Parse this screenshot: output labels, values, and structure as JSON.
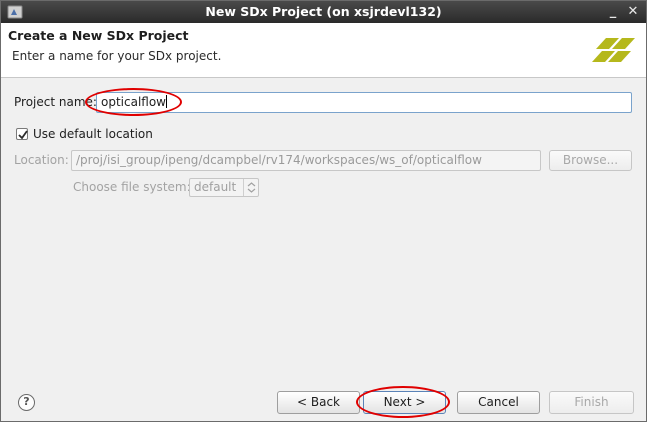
{
  "window": {
    "title": "New SDx Project  (on xsjrdevl132)",
    "controls": {
      "minimize": "_",
      "close": "✕"
    }
  },
  "header": {
    "title": "Create a New SDx Project",
    "subtitle": "Enter a name for your SDx project.",
    "logo": "xilinx-logo-icon"
  },
  "form": {
    "project_name_label": "Project name:",
    "project_name_value": "opticalflow",
    "use_default_label": "Use default location",
    "use_default_checked": true,
    "location_label": "Location:",
    "location_value": "/proj/isi_group/ipeng/dcampbel/rv174/workspaces/ws_of/opticalflow",
    "browse_label": "Browse...",
    "filesystem_label": "Choose file system:",
    "filesystem_value": "default"
  },
  "footer": {
    "help_icon": "help-icon",
    "help_glyph": "?",
    "back_label": "< Back",
    "next_label": "Next >",
    "cancel_label": "Cancel",
    "finish_label": "Finish"
  },
  "colors": {
    "annotation": "#e00000",
    "logo": "#b5b81c"
  }
}
